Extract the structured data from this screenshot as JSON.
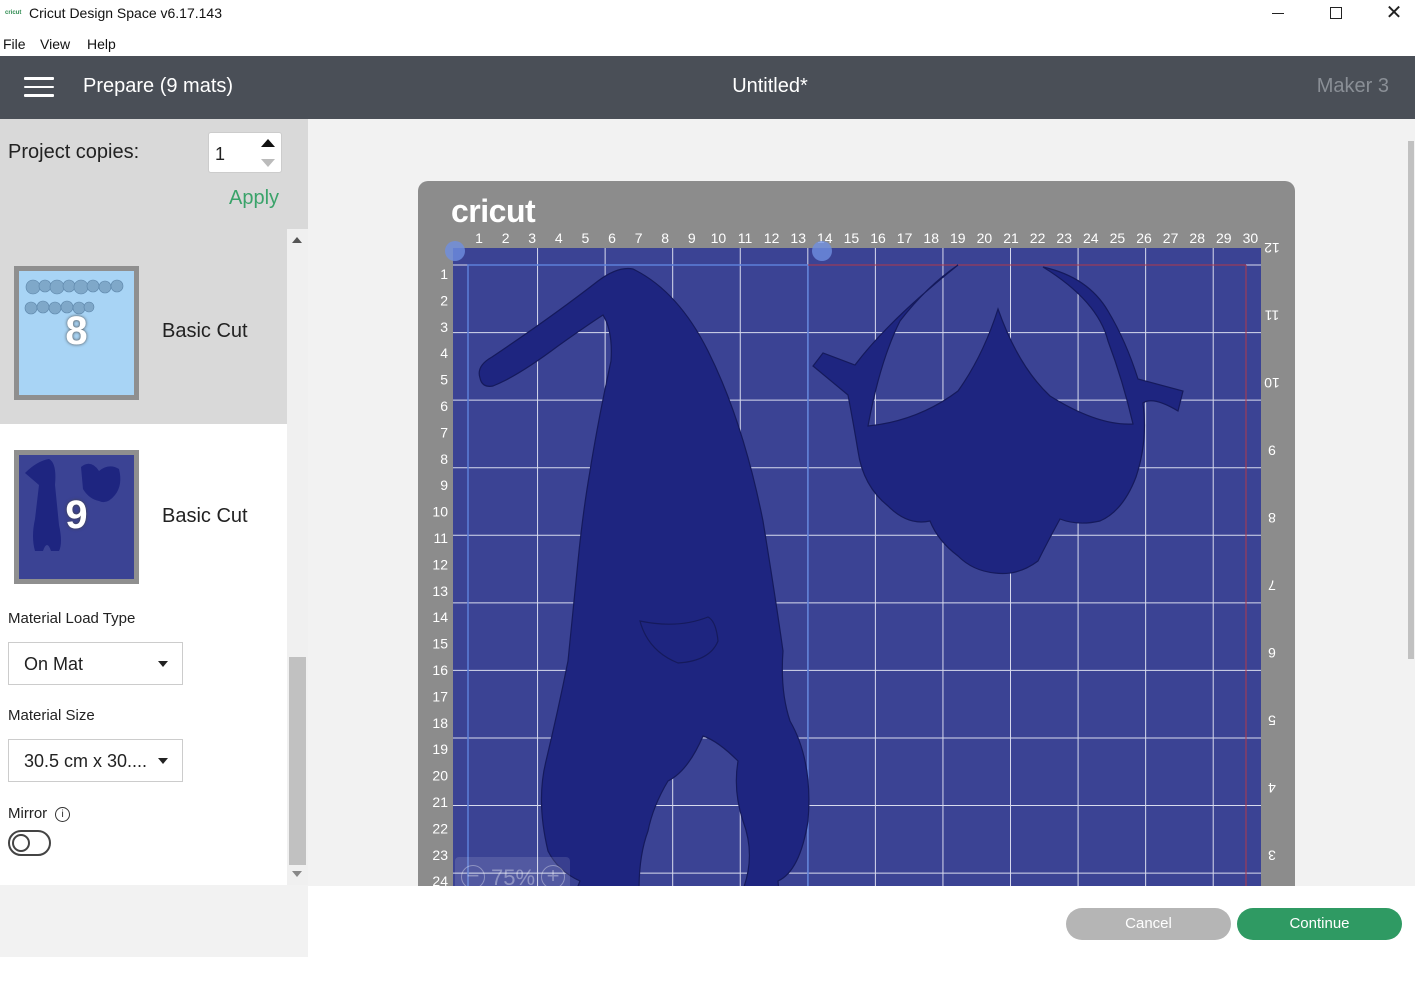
{
  "window": {
    "title": "Cricut Design Space  v6.17.143",
    "icon_text": "cricut",
    "minimize": "",
    "close": "✕"
  },
  "menu": [
    "File",
    "View",
    "Help"
  ],
  "header": {
    "prepare_label": "Prepare (9 mats)",
    "document_title": "Untitled*",
    "machine": "Maker 3"
  },
  "sidebar": {
    "copies_label": "Project copies:",
    "copies_value": "1",
    "apply_label": "Apply",
    "mats": [
      {
        "number": "8",
        "label": "Basic Cut",
        "selected": true
      },
      {
        "number": "9",
        "label": "Basic Cut",
        "selected": false
      }
    ],
    "load_type_label": "Material Load Type",
    "load_type_value": "On Mat",
    "size_label": "Material Size",
    "size_value": "30.5 cm x 30....",
    "mirror_label": "Mirror",
    "mirror_on": false,
    "info_icon": "i"
  },
  "canvas": {
    "mat_logo": "cricut",
    "top_ruler": [
      "1",
      "2",
      "3",
      "4",
      "5",
      "6",
      "7",
      "8",
      "9",
      "10",
      "11",
      "12",
      "13",
      "14",
      "15",
      "16",
      "17",
      "18",
      "19",
      "20",
      "21",
      "22",
      "23",
      "24",
      "25",
      "26",
      "27",
      "28",
      "29",
      "30"
    ],
    "left_ruler": [
      "1",
      "2",
      "3",
      "4",
      "5",
      "6",
      "7",
      "8",
      "9",
      "10",
      "11",
      "12",
      "13",
      "14",
      "15",
      "16",
      "17",
      "18",
      "19",
      "20",
      "21",
      "22",
      "23",
      "24"
    ],
    "right_ruler": [
      "12",
      "11",
      "10",
      "9",
      "8",
      "7",
      "6",
      "5",
      "4",
      "3"
    ],
    "zoom_label": "75%",
    "zoom_minus": "−",
    "zoom_plus": "+",
    "colors": {
      "mat_grid": "#3b4394",
      "shape_fill": "#1e2580",
      "grid_line": "#d8dbee"
    }
  },
  "footer": {
    "cancel_label": "Cancel",
    "continue_label": "Continue"
  }
}
